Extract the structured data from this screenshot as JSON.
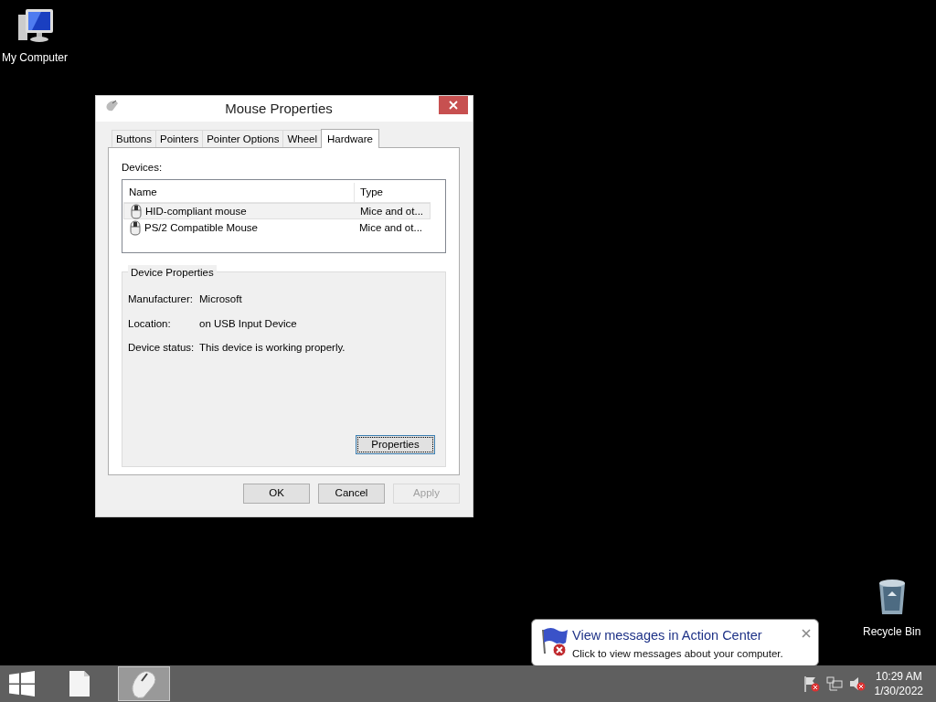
{
  "desktop_icons": [
    {
      "kind": "computer",
      "label": "My Computer"
    },
    {
      "kind": "recycle",
      "label": "Recycle Bin"
    }
  ],
  "window": {
    "title": "Mouse Properties",
    "tabs": [
      {
        "label": "Buttons",
        "selected": false
      },
      {
        "label": "Pointers",
        "selected": false
      },
      {
        "label": "Pointer Options",
        "selected": false
      },
      {
        "label": "Wheel",
        "selected": false
      },
      {
        "label": "Hardware",
        "selected": true
      }
    ],
    "devices_label": "Devices:",
    "columns": [
      "Name",
      "Type"
    ],
    "devices": [
      {
        "name": "HID-compliant mouse",
        "type": "Mice and ot...",
        "selected": true
      },
      {
        "name": "PS/2 Compatible Mouse",
        "type": "Mice and ot...",
        "selected": false
      }
    ],
    "device_properties": {
      "title": "Device Properties",
      "fields": [
        {
          "label": "Manufacturer:",
          "value": "Microsoft"
        },
        {
          "label": "Location:",
          "value": "on USB Input Device"
        },
        {
          "label": "Device status:",
          "value": "This device is working properly."
        }
      ]
    },
    "properties_button": "Properties",
    "buttons": [
      {
        "label": "OK",
        "disabled": false
      },
      {
        "label": "Cancel",
        "disabled": false
      },
      {
        "label": "Apply",
        "disabled": true
      }
    ]
  },
  "notification": {
    "title": "View messages in Action Center",
    "message": "Click to view messages about your computer."
  },
  "taskbar": {
    "apps": [
      {
        "kind": "file",
        "selected": false
      },
      {
        "kind": "mouse",
        "selected": true
      }
    ],
    "time": "10:29 AM",
    "date": "1/30/2022"
  }
}
